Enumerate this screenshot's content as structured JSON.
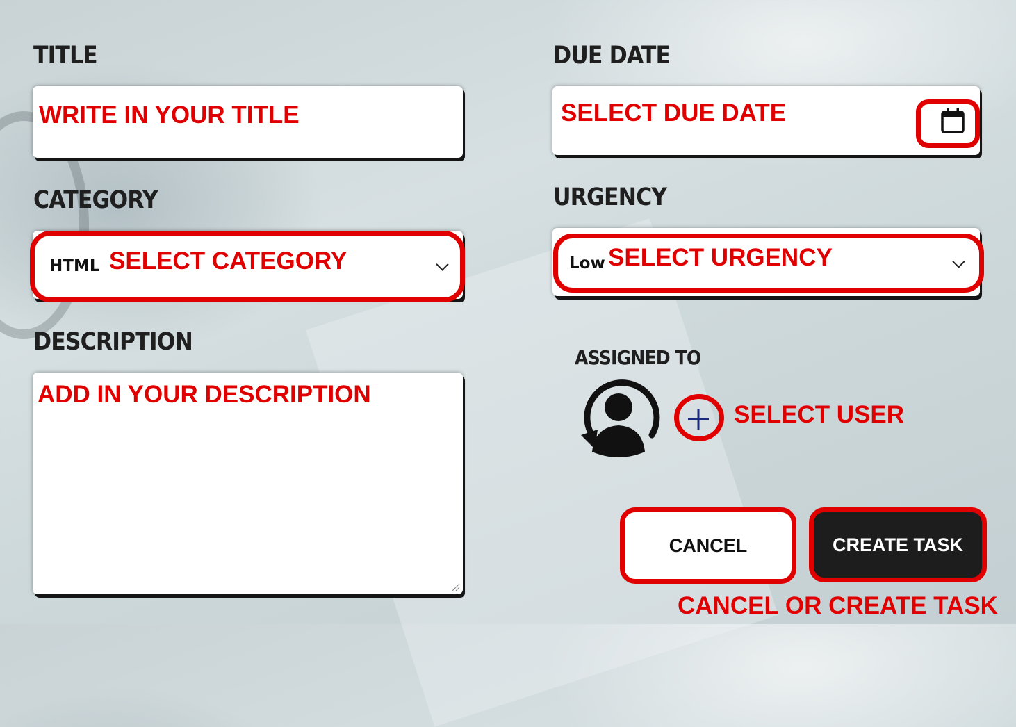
{
  "form": {
    "title": {
      "label": "TITLE",
      "annotation": "WRITE IN YOUR TITLE"
    },
    "category": {
      "label": "CATEGORY",
      "selected": "HTML",
      "annotation": "SELECT CATEGORY",
      "icon": "chevron-down-icon"
    },
    "description": {
      "label": "DESCRIPTION",
      "annotation": "ADD IN YOUR DESCRIPTION"
    },
    "due_date": {
      "label": "DUE DATE",
      "annotation": "SELECT DUE DATE",
      "icon": "calendar-icon"
    },
    "urgency": {
      "label": "URGENCY",
      "selected": "Low",
      "annotation": "SELECT URGENCY",
      "icon": "chevron-down-icon"
    },
    "assigned_to": {
      "label": "ASSIGNED TO",
      "annotation": "SELECT USER",
      "avatar_icon": "user-sync-icon",
      "add_icon": "plus-icon"
    }
  },
  "actions": {
    "cancel_label": "CANCEL",
    "create_label": "CREATE TASK",
    "annotation": "CANCEL OR CREATE TASK"
  },
  "colors": {
    "annotation_red": "#e00000",
    "create_button_bg": "#1d1d1d",
    "label_text": "#1f1f1f"
  }
}
